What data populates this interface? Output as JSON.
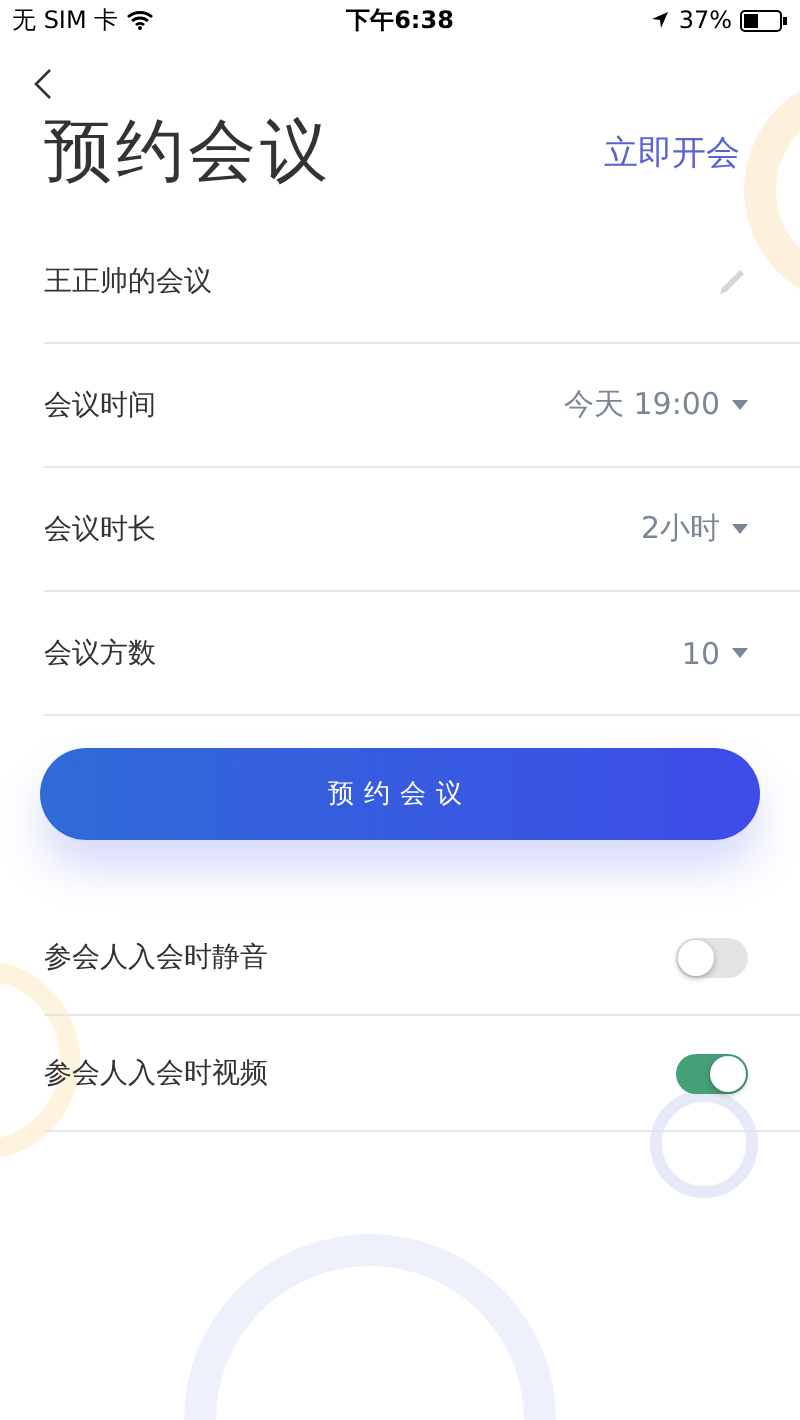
{
  "status_bar": {
    "carrier": "无 SIM 卡",
    "time": "下午6:38",
    "battery": "37%"
  },
  "header": {
    "title": "预约会议",
    "action": "立即开会"
  },
  "rows": [
    {
      "kind": "edit",
      "label": "王正帅的会议"
    },
    {
      "kind": "select",
      "label": "会议时间",
      "value": "今天 19:00"
    },
    {
      "kind": "select",
      "label": "会议时长",
      "value": "2小时"
    },
    {
      "kind": "select",
      "label": "会议方数",
      "value": "10"
    }
  ],
  "submit": "预约会议",
  "toggles": [
    {
      "label": "参会人入会时静音",
      "on": false
    },
    {
      "label": "参会人入会时视频",
      "on": true
    }
  ]
}
